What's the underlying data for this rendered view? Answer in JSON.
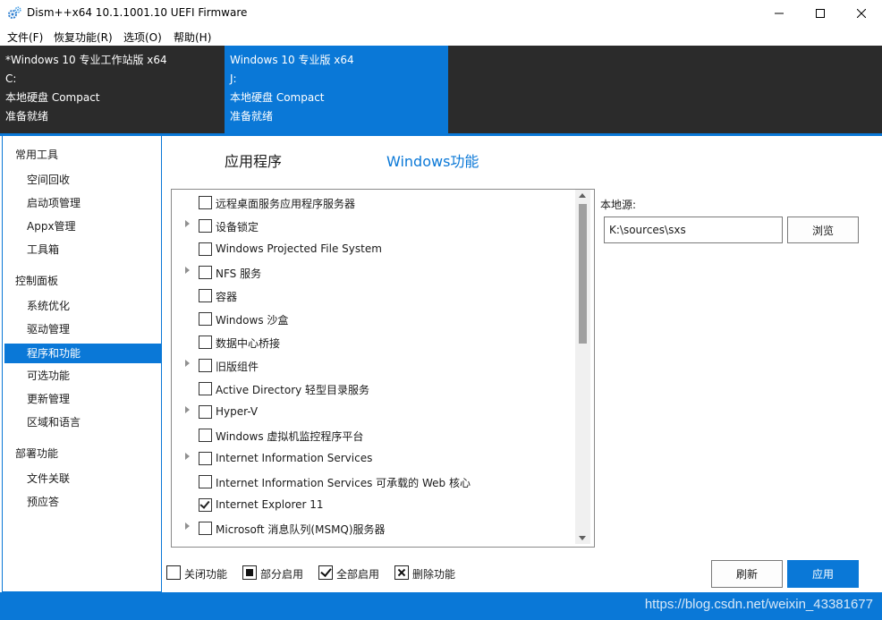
{
  "window": {
    "title": "Dism++x64 10.1.1001.10 UEFI Firmware",
    "icon": "gears-icon"
  },
  "menu": [
    {
      "label": "文件(F)"
    },
    {
      "label": "恢复功能(R)"
    },
    {
      "label": "选项(O)"
    },
    {
      "label": "帮助(H)"
    }
  ],
  "sessions": [
    {
      "name": "*Windows 10 专业工作站版 x64",
      "drive": "C:",
      "storage": "本地硬盘 Compact",
      "status": "准备就绪",
      "selected": false
    },
    {
      "name": "Windows 10 专业版 x64",
      "drive": "J:",
      "storage": "本地硬盘 Compact",
      "status": "准备就绪",
      "selected": true
    }
  ],
  "sidebar": {
    "groups": [
      {
        "label": "常用工具",
        "items": [
          "空间回收",
          "启动项管理",
          "Appx管理",
          "工具箱"
        ]
      },
      {
        "label": "控制面板",
        "items": [
          "系统优化",
          "驱动管理",
          "程序和功能",
          "可选功能",
          "更新管理",
          "区域和语言"
        ]
      },
      {
        "label": "部署功能",
        "items": [
          "文件关联",
          "预应答"
        ]
      }
    ],
    "selected_item": "程序和功能"
  },
  "tabs": {
    "apps": "应用程序",
    "features": "Windows功能",
    "active": "features"
  },
  "features": [
    {
      "label": "远程桌面服务应用程序服务器",
      "expandable": false,
      "checked": false
    },
    {
      "label": "设备锁定",
      "expandable": true,
      "checked": false
    },
    {
      "label": "Windows Projected File System",
      "expandable": false,
      "checked": false
    },
    {
      "label": "NFS 服务",
      "expandable": true,
      "checked": false
    },
    {
      "label": "容器",
      "expandable": false,
      "checked": false
    },
    {
      "label": "Windows 沙盒",
      "expandable": false,
      "checked": false
    },
    {
      "label": "数据中心桥接",
      "expandable": false,
      "checked": false
    },
    {
      "label": "旧版组件",
      "expandable": true,
      "checked": false
    },
    {
      "label": "Active Directory 轻型目录服务",
      "expandable": false,
      "checked": false
    },
    {
      "label": "Hyper-V",
      "expandable": true,
      "checked": false
    },
    {
      "label": "Windows 虚拟机监控程序平台",
      "expandable": false,
      "checked": false
    },
    {
      "label": "Internet Information Services",
      "expandable": true,
      "checked": false
    },
    {
      "label": "Internet Information Services 可承载的 Web 核心",
      "expandable": false,
      "checked": false
    },
    {
      "label": "Internet Explorer 11",
      "expandable": false,
      "checked": true
    },
    {
      "label": "Microsoft 消息队列(MSMQ)服务器",
      "expandable": true,
      "checked": false
    }
  ],
  "local_source": {
    "label": "本地源:",
    "value": "K:\\sources\\sxs",
    "browse_label": "浏览"
  },
  "legend": {
    "off": "关闭功能",
    "partial": "部分启用",
    "all": "全部启用",
    "remove": "删除功能"
  },
  "actions": {
    "refresh": "刷新",
    "apply": "应用"
  },
  "watermark": "https://blog.csdn.net/weixin_43381677",
  "colors": {
    "accent": "#0a78d7",
    "session_bar": "#2b2b2b"
  }
}
